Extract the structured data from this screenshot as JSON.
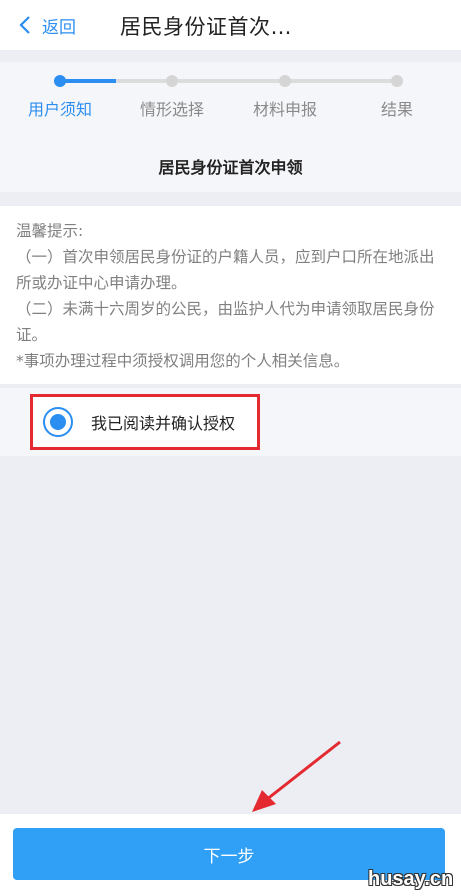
{
  "header": {
    "back_label": "返回",
    "title": "居民身份证首次…"
  },
  "steps": [
    {
      "label": "用户须知",
      "active": true
    },
    {
      "label": "情形选择",
      "active": false
    },
    {
      "label": "材料申报",
      "active": false
    },
    {
      "label": "结果",
      "active": false
    }
  ],
  "section": {
    "title": "居民身份证首次申领"
  },
  "notice": {
    "heading": "温馨提示:",
    "line1": "（一）首次申领居民身份证的户籍人员，应到户口所在地派出所或办证中心申请办理。",
    "line2": "（二）未满十六周岁的公民，由监护人代为申请领取居民身份证。",
    "line3": "*事项办理过程中须授权调用您的个人相关信息。"
  },
  "confirm": {
    "label": "我已阅读并确认授权",
    "checked": true
  },
  "footer": {
    "next_label": "下一步"
  },
  "colors": {
    "accent": "#2b8ef0",
    "button": "#2fa0f5",
    "highlight": "#e32a30"
  },
  "watermark": "husay.cn"
}
